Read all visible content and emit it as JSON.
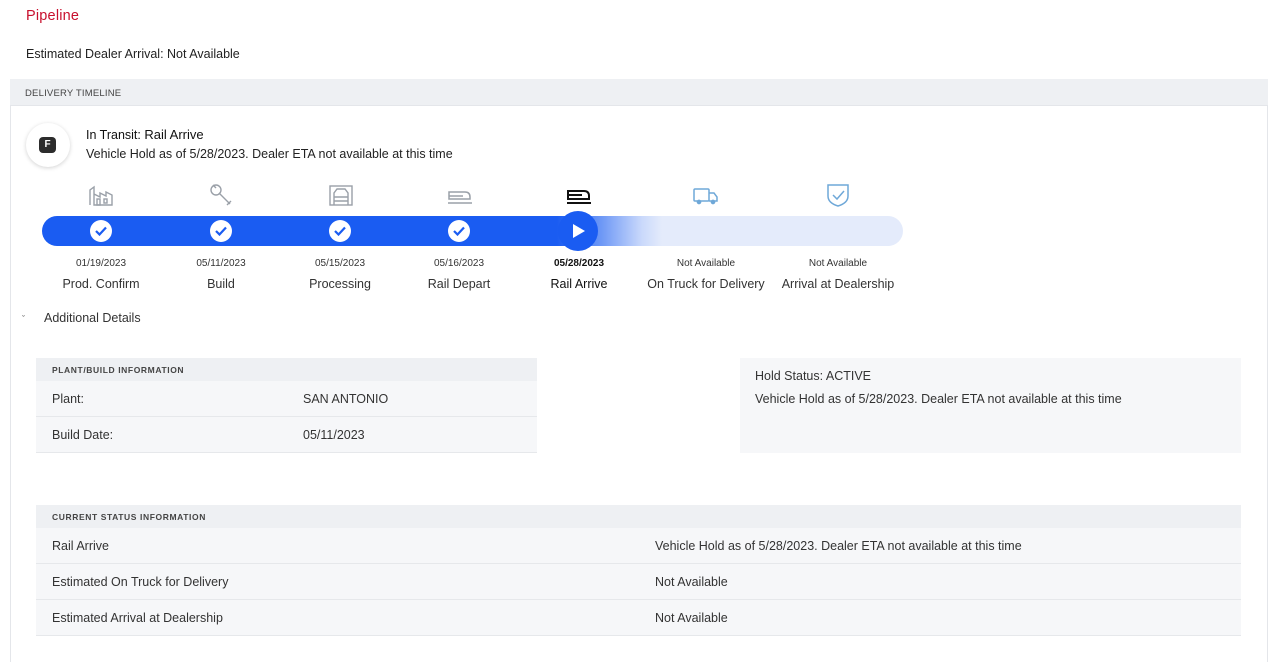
{
  "page": {
    "title": "Pipeline",
    "estimated_arrival": "Estimated Dealer Arrival: Not Available"
  },
  "timeline": {
    "header": "DELIVERY TIMELINE",
    "badge_letter": "F",
    "status_prefix": "In Transit:",
    "status_value": "Rail Arrive",
    "status_note": "Vehicle Hold as of 5/28/2023. Dealer ETA not available at this time",
    "accent_color": "#1a5cf2",
    "current_step": 5,
    "steps": [
      {
        "icon": "factory-icon",
        "date": "01/19/2023",
        "label": "Prod. Confirm",
        "state": "complete"
      },
      {
        "icon": "wrench-icon",
        "date": "05/11/2023",
        "label": "Build",
        "state": "complete"
      },
      {
        "icon": "processing-icon",
        "date": "05/15/2023",
        "label": "Processing",
        "state": "complete"
      },
      {
        "icon": "train-icon",
        "date": "05/16/2023",
        "label": "Rail Depart",
        "state": "complete"
      },
      {
        "icon": "train-icon",
        "date": "05/28/2023",
        "label": "Rail Arrive",
        "state": "current"
      },
      {
        "icon": "truck-icon",
        "date": "Not Available",
        "label": "On Truck for Delivery",
        "state": "pending"
      },
      {
        "icon": "shield-check-icon",
        "date": "Not Available",
        "label": "Arrival at Dealership",
        "state": "pending"
      }
    ]
  },
  "additional_details": {
    "label": "Additional Details",
    "expanded": true
  },
  "plant_info": {
    "header": "PLANT/BUILD INFORMATION",
    "rows": [
      {
        "label": "Plant:",
        "value": "SAN ANTONIO"
      },
      {
        "label": "Build Date:",
        "value": "05/11/2023"
      }
    ]
  },
  "hold": {
    "status": "Hold Status: ACTIVE",
    "note": "Vehicle Hold as of 5/28/2023. Dealer ETA not available at this time"
  },
  "current_status": {
    "header": "CURRENT STATUS INFORMATION",
    "rows": [
      {
        "label": "Rail Arrive",
        "value": "Vehicle Hold as of 5/28/2023. Dealer ETA not available at this time"
      },
      {
        "label": "Estimated On Truck for Delivery",
        "value": "Not Available"
      },
      {
        "label": "Estimated Arrival at Dealership",
        "value": "Not Available"
      }
    ]
  }
}
